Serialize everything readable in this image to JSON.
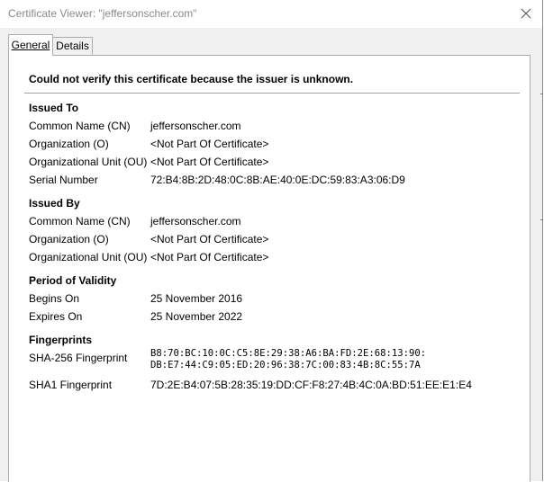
{
  "window": {
    "title": "Certificate Viewer: \"jeffersonscher.com\"",
    "close_icon": "close-icon"
  },
  "tabs": [
    {
      "label": "General",
      "active": true
    },
    {
      "label": "Details",
      "active": false
    }
  ],
  "general": {
    "warning": "Could not verify this certificate because the issuer is unknown.",
    "issued_to": {
      "heading": "Issued To",
      "cn_label": "Common Name (CN)",
      "cn_value": "jeffersonscher.com",
      "o_label": "Organization (O)",
      "o_value": "<Not Part Of Certificate>",
      "ou_label": "Organizational Unit (OU)",
      "ou_value": "<Not Part Of Certificate>",
      "serial_label": "Serial Number",
      "serial_value": "72:B4:8B:2D:48:0C:8B:AE:40:0E:DC:59:83:A3:06:D9"
    },
    "issued_by": {
      "heading": "Issued By",
      "cn_label": "Common Name (CN)",
      "cn_value": "jeffersonscher.com",
      "o_label": "Organization (O)",
      "o_value": "<Not Part Of Certificate>",
      "ou_label": "Organizational Unit (OU)",
      "ou_value": "<Not Part Of Certificate>"
    },
    "validity": {
      "heading": "Period of Validity",
      "begins_label": "Begins On",
      "begins_value": "25 November 2016",
      "expires_label": "Expires On",
      "expires_value": "25 November 2022"
    },
    "fingerprints": {
      "heading": "Fingerprints",
      "sha256_label": "SHA-256 Fingerprint",
      "sha256_line1": "B8:70:BC:10:0C:C5:8E:29:38:A6:BA:FD:2E:68:13:90:",
      "sha256_line2": "DB:E7:44:C9:05:ED:20:96:38:7C:00:83:4B:8C:55:7A",
      "sha1_label": "SHA1 Fingerprint",
      "sha1_value": "7D:2E:B4:07:5B:28:35:19:DD:CF:F8:27:4B:4C:0A:BD:51:EE:E1:E4"
    }
  }
}
